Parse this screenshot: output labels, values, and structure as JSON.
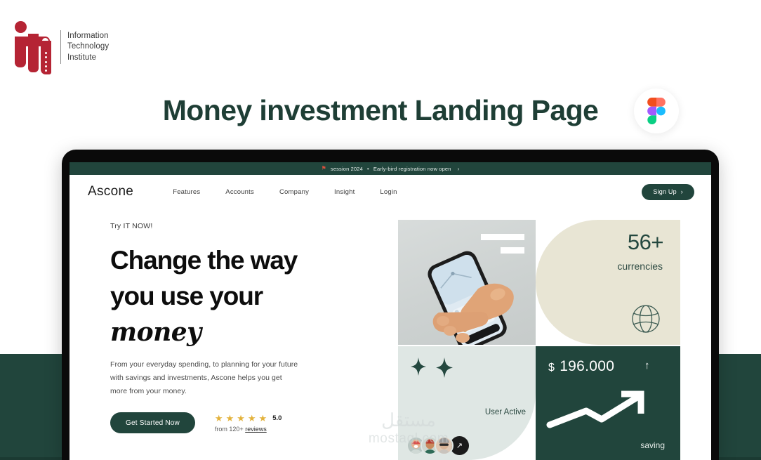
{
  "logo": {
    "mark_color": "#B52434",
    "name": "iti-logo",
    "text": "Information\nTechnology\nInstitute"
  },
  "header": {
    "title": "Money investment Landing Page",
    "title_color": "#1E3E35",
    "badge_icon": "figma-icon"
  },
  "mockup": {
    "device": "laptop",
    "site": {
      "announcement": {
        "pin_icon": "pin-flag-icon",
        "session": "session 2024",
        "separator": "•",
        "message": "Early-bird registration now open",
        "chevron": "›"
      },
      "nav": {
        "brand": "Ascone",
        "links": [
          {
            "label": "Features"
          },
          {
            "label": "Accounts"
          },
          {
            "label": "Company"
          },
          {
            "label": "Insight"
          },
          {
            "label": "Login"
          }
        ],
        "signup_label": "Sign Up",
        "signup_chevron": "›"
      },
      "hero": {
        "eyebrow": "Try IT NOW!",
        "headline_line1": "Change the way",
        "headline_line2": "you use your",
        "headline_script": "money",
        "body": "From your everyday spending, to planning for your future\nwith savings and investments, Ascone helps you get\nmore from your money.",
        "cta_label": "Get Started Now",
        "rating": {
          "stars": 5,
          "star_glyph": "★",
          "star_color": "#E3B23C",
          "score": "5.0",
          "sub_prefix": "from 120+ ",
          "sub_link": "reviews"
        }
      },
      "cards": {
        "phone": {
          "name": "phone-in-hand-image",
          "alt": "hand holding smartphone"
        },
        "currency": {
          "value": "56+",
          "label": "currencies",
          "icon": "globe-icon",
          "bg": "#E8E5D4"
        },
        "user_active": {
          "label": "User Active",
          "sparkle_icon": "sparkle-icon",
          "avatar_count": 3,
          "more_icon": "arrow-up-right-icon",
          "bg": "#DFE7E4"
        },
        "saving": {
          "currency_symbol": "$",
          "amount": "196.000",
          "trend_arrow": "↑",
          "chart_icon": "trend-up-arrow-icon",
          "label": "saving",
          "bg": "#21453C"
        }
      }
    }
  },
  "watermark": {
    "arabic": "مستقل",
    "latin": "mostaql.com"
  },
  "theme": {
    "brand_green": "#21453C",
    "band_color": "#21453C",
    "page_bg": "#FFFFFF"
  }
}
